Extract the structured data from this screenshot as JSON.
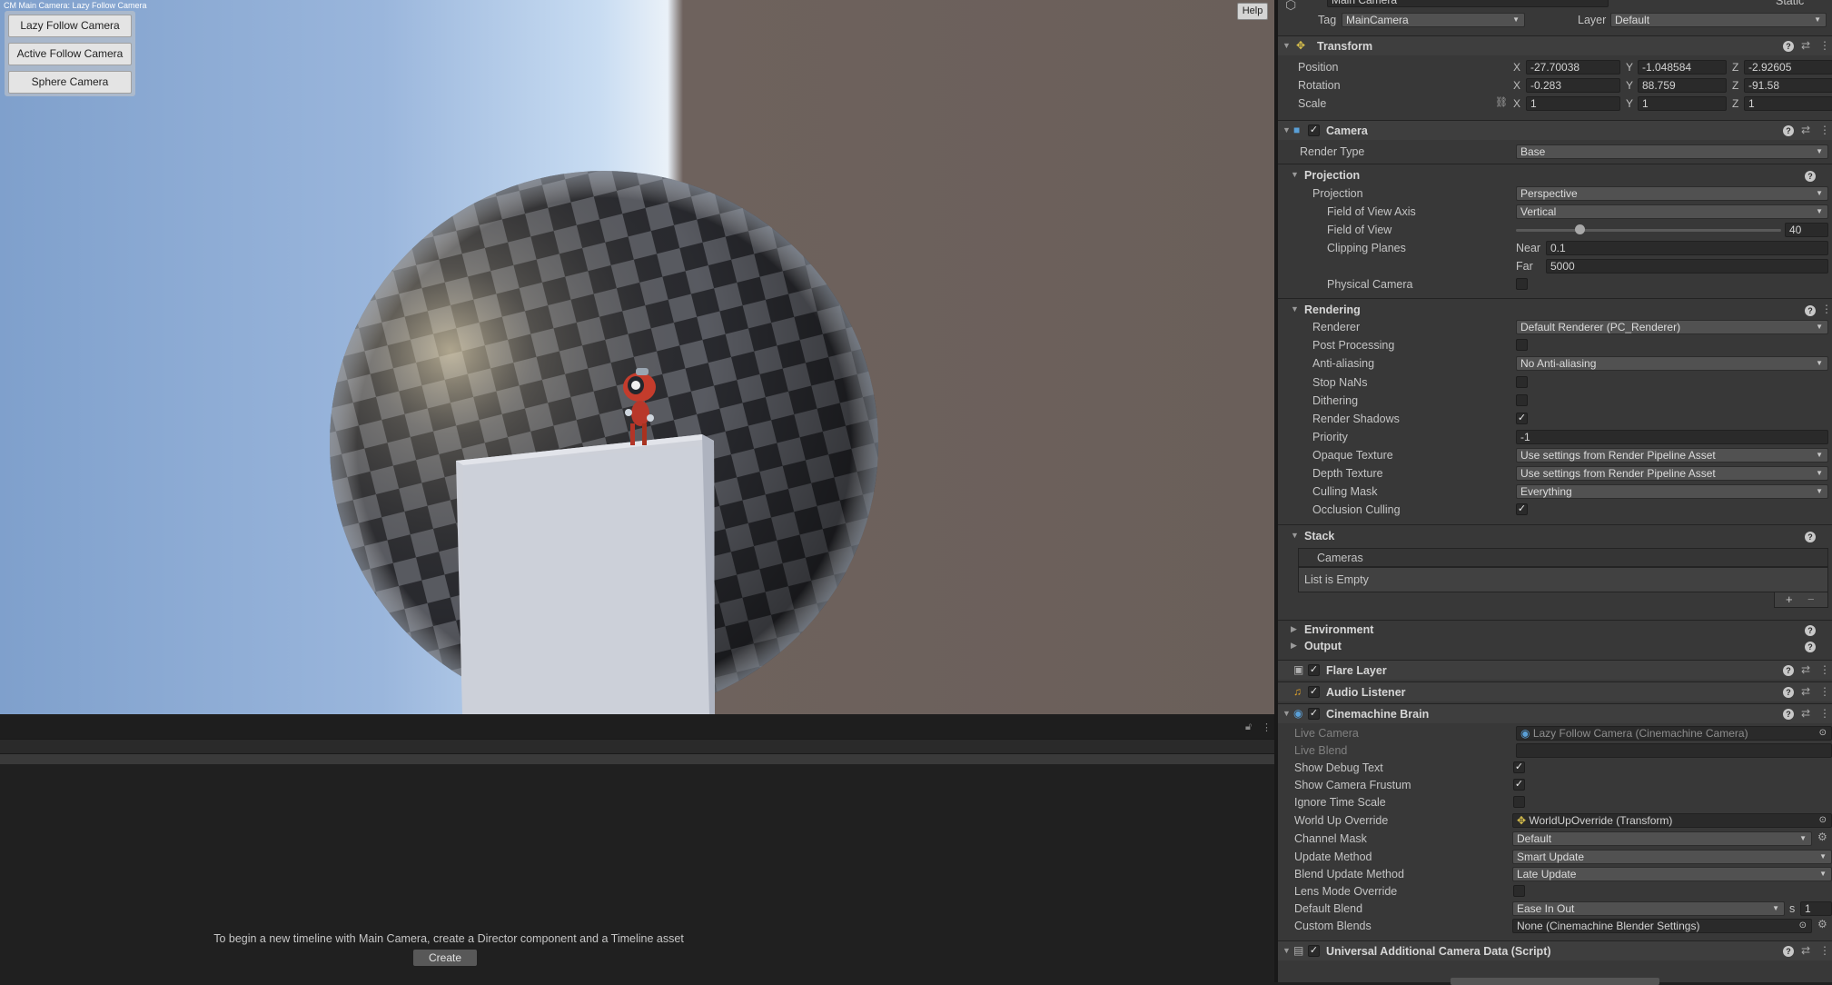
{
  "game_view": {
    "title": "CM Main Camera: Lazy Follow Camera",
    "help_label": "Help",
    "camera_buttons": [
      "Lazy Follow Camera",
      "Active Follow Camera",
      "Sphere Camera"
    ]
  },
  "timeline": {
    "message": "To begin a new timeline with Main Camera, create a Director component and a Timeline asset",
    "create_label": "Create"
  },
  "inspector": {
    "object": {
      "name": "Main Camera",
      "static_label": "Static",
      "tag_label": "Tag",
      "tag": "MainCamera",
      "layer_label": "Layer",
      "layer": "Default"
    },
    "transform": {
      "title": "Transform",
      "position_label": "Position",
      "rotation_label": "Rotation",
      "scale_label": "Scale",
      "position": {
        "x": "-27.70038",
        "y": "-1.048584",
        "z": "-2.92605"
      },
      "rotation": {
        "x": "-0.283",
        "y": "88.759",
        "z": "-91.58"
      },
      "scale": {
        "x": "1",
        "y": "1",
        "z": "1"
      },
      "axis_x": "X",
      "axis_y": "Y",
      "axis_z": "Z"
    },
    "camera": {
      "title": "Camera",
      "render_type_label": "Render Type",
      "render_type": "Base",
      "projection_section": "Projection",
      "projection_label": "Projection",
      "projection": "Perspective",
      "fov_axis_label": "Field of View Axis",
      "fov_axis": "Vertical",
      "fov_label": "Field of View",
      "fov": "40",
      "fov_slider_fraction": 0.24,
      "clipping_label": "Clipping Planes",
      "near_label": "Near",
      "near": "0.1",
      "far_label": "Far",
      "far": "5000",
      "physical_label": "Physical Camera",
      "rendering_section": "Rendering",
      "renderer_label": "Renderer",
      "renderer": "Default Renderer (PC_Renderer)",
      "post_label": "Post Processing",
      "aa_label": "Anti-aliasing",
      "aa": "No Anti-aliasing",
      "nans_label": "Stop NaNs",
      "dither_label": "Dithering",
      "shadows_label": "Render Shadows",
      "priority_label": "Priority",
      "priority": "-1",
      "opaque_label": "Opaque Texture",
      "opaque": "Use settings from Render Pipeline Asset",
      "depth_label": "Depth Texture",
      "depth": "Use settings from Render Pipeline Asset",
      "culling_label": "Culling Mask",
      "culling": "Everything",
      "occlusion_label": "Occlusion Culling",
      "stack_section": "Stack",
      "cameras_label": "Cameras",
      "list_empty": "List is Empty",
      "environment_section": "Environment",
      "output_section": "Output"
    },
    "flare_title": "Flare Layer",
    "audio_title": "Audio Listener",
    "brain": {
      "title": "Cinemachine Brain",
      "live_camera_label": "Live Camera",
      "live_camera": "Lazy Follow Camera (Cinemachine Camera)",
      "live_blend_label": "Live Blend",
      "debug_label": "Show Debug Text",
      "frustum_label": "Show Camera Frustum",
      "ignore_label": "Ignore Time Scale",
      "worldup_label": "World Up Override",
      "worldup": "WorldUpOverride (Transform)",
      "channel_label": "Channel Mask",
      "channel": "Default",
      "update_label": "Update Method",
      "update": "Smart Update",
      "blend_update_label": "Blend Update Method",
      "blend_update": "Late Update",
      "lens_label": "Lens Mode Override",
      "default_blend_label": "Default Blend",
      "default_blend": "Ease In Out",
      "s_label": "s",
      "blend_time": "1",
      "custom_label": "Custom Blends",
      "custom": "None (Cinemachine Blender Settings)"
    },
    "uacd_title": "Universal Additional Camera Data (Script)"
  }
}
